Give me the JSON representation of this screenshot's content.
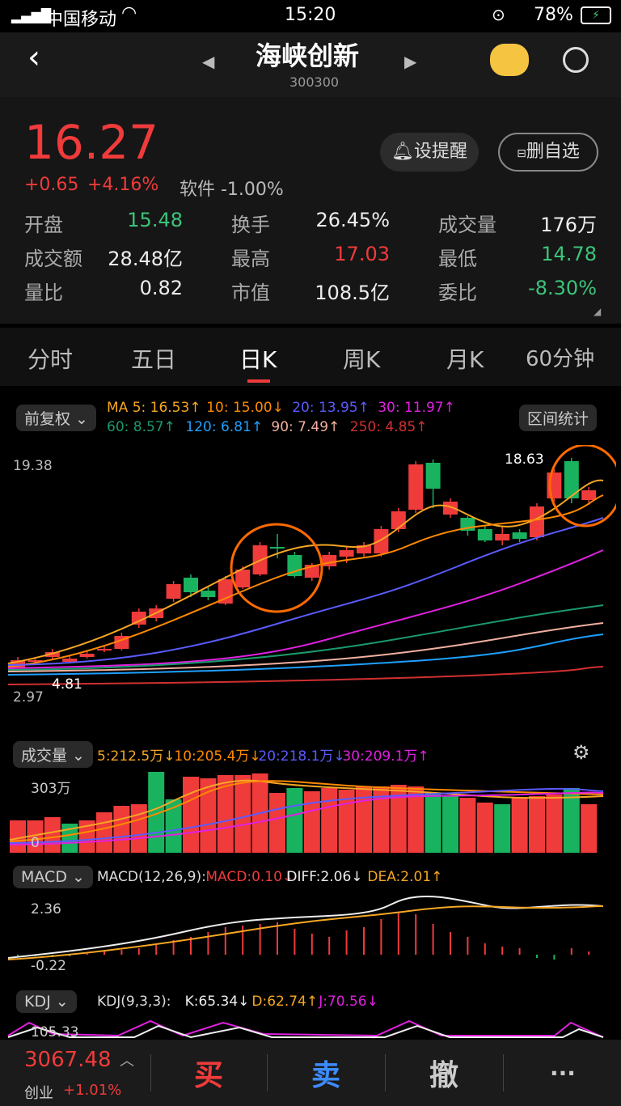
{
  "status": {
    "carrier": "中国移动",
    "time": "15:20",
    "battery": "78%"
  },
  "header": {
    "name": "海峡创新",
    "code": "300300"
  },
  "quote": {
    "price": "16.27",
    "change": "+0.65",
    "pct": "+4.16%",
    "sector": "软件 -1.00%",
    "remind_btn": "设提醒",
    "fav_btn": "删自选",
    "stats": [
      {
        "l": "开盘",
        "v": "15.48"
      },
      {
        "l": "换手",
        "v": "26.45%"
      },
      {
        "l": "成交量",
        "v": "176万"
      },
      {
        "l": "成交额",
        "v": "28.48亿"
      },
      {
        "l": "最高",
        "v": "17.03"
      },
      {
        "l": "最低",
        "v": "14.78"
      },
      {
        "l": "量比",
        "v": "0.82"
      },
      {
        "l": "市值",
        "v": "108.5亿"
      },
      {
        "l": "委比",
        "v": "-8.30%"
      }
    ]
  },
  "tabs": [
    "分时",
    "五日",
    "日K",
    "周K",
    "月K",
    "60分钟"
  ],
  "kpanel": {
    "adj": "前复权",
    "range_btn": "区间统计",
    "ma_row1": [
      {
        "t": "MA 5: 16.53↑",
        "c": "#f5a623"
      },
      {
        "t": "10: 15.00↓",
        "c": "#ff8a00"
      },
      {
        "t": "20: 13.95↑",
        "c": "#5b5bff"
      },
      {
        "t": "30: 11.97↑",
        "c": "#e020e0"
      }
    ],
    "ma_row2": [
      {
        "t": "60: 8.57↑",
        "c": "#1b9a6b"
      },
      {
        "t": "120: 6.81↑",
        "c": "#1ea0ff"
      },
      {
        "t": "90: 7.49↑",
        "c": "#f0b0a0"
      },
      {
        "t": "250: 4.85↑",
        "c": "#d03030"
      }
    ],
    "top_label": "19.38",
    "bottom_label": "2.97",
    "low_mark": "4.81",
    "high_mark": "18.63"
  },
  "vol": {
    "label": "成交量",
    "legend": [
      {
        "t": "5:212.5万↓",
        "c": "#f5a623"
      },
      {
        "t": "10:205.4万↓",
        "c": "#ff8a00"
      },
      {
        "t": "20:218.1万↓",
        "c": "#5b5bff"
      },
      {
        "t": "30:209.1万↑",
        "c": "#e020e0"
      }
    ],
    "top": "303万",
    "zero": "0"
  },
  "macd": {
    "label": "MACD",
    "legend": [
      {
        "t": "MACD(12,26,9):",
        "c": "#ddd"
      },
      {
        "t": "MACD:0.10↓",
        "c": "#f03b3b"
      },
      {
        "t": "DIFF:2.06↓",
        "c": "#eee"
      },
      {
        "t": "DEA:2.01↑",
        "c": "#f5a623"
      }
    ],
    "top": "2.36",
    "bottom": "-0.22"
  },
  "kdj": {
    "label": "KDJ",
    "legend": [
      {
        "t": "KDJ(9,3,3):",
        "c": "#ddd"
      },
      {
        "t": "K:65.34↓",
        "c": "#eee"
      },
      {
        "t": "D:62.74↑",
        "c": "#f5a623"
      },
      {
        "t": "J:70.56↓",
        "c": "#e020e0"
      }
    ],
    "top": "105.33"
  },
  "bottom": {
    "index_value": "3067.48",
    "index_name": "创业",
    "index_pct": "+1.01%",
    "buy": "买",
    "sell": "卖",
    "cancel": "撤",
    "more": "···"
  },
  "colors": {
    "up": "#f03b3b",
    "down": "#19b25f"
  }
}
